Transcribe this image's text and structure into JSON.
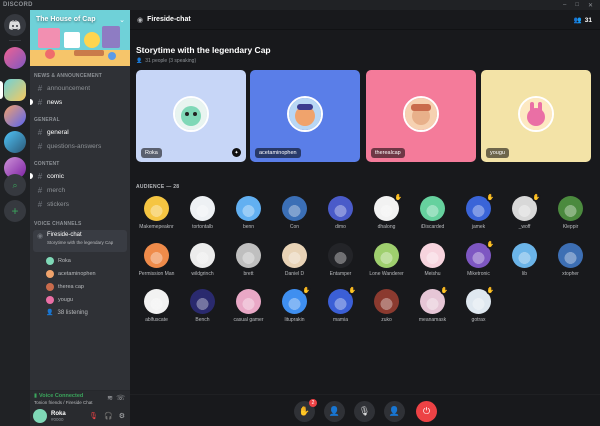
{
  "window": {
    "title": "DISCORD"
  },
  "servers": [
    {
      "name": "discord-home",
      "color": "#36393f"
    },
    {
      "name": "server-1",
      "color": "#9b59b6"
    },
    {
      "name": "server-2",
      "color": "#3ba55c"
    },
    {
      "name": "server-3",
      "color": "#faa61a"
    },
    {
      "name": "server-4",
      "color": "#5865f2"
    },
    {
      "name": "server-5",
      "color": "#eb459e"
    }
  ],
  "server": {
    "name": "The House of Cap"
  },
  "categories": {
    "news": "NEWS & ANNOUNCEMENT",
    "general": "GENERAL",
    "content": "CONTENT",
    "voice": "VOICE CHANNELS"
  },
  "channels": {
    "announcement": "announcement",
    "news": "news",
    "general": "general",
    "questions": "questions-answers",
    "comic": "comic",
    "merch": "merch",
    "stickers": "stickers",
    "fireside": "Fireside-chat",
    "fireside_topic": "Storytime with the legendary Cap"
  },
  "voice_users": [
    "Roka",
    "acetaminophen",
    "therea cap",
    "yougu"
  ],
  "listening": "38 listening",
  "voice_panel": {
    "status": "Voice Connected",
    "channel": "Tonion friends / Fireside Chat"
  },
  "user": {
    "name": "Roka",
    "tag": "#0000"
  },
  "stage": {
    "channel": "Fireside-chat",
    "member_count": "31",
    "title": "Storytime with the legendary Cap",
    "subtitle": "31 people (3 speaking)",
    "audience_label": "AUDIENCE — 28"
  },
  "speakers": [
    {
      "name": "Roka",
      "bg": "#c7d6f7",
      "avatar": "#7fd8b7"
    },
    {
      "name": "acetaminophen",
      "bg": "#5a7ee8",
      "avatar": "#f0a36c"
    },
    {
      "name": "therealcap",
      "bg": "#f47b9a",
      "avatar": "#c96b4c"
    },
    {
      "name": "yougu",
      "bg": "#f3e3a7",
      "avatar": "#ea6fa5"
    }
  ],
  "audience": [
    {
      "name": "Makemepeaknr",
      "color": "#f5c542",
      "hand": false
    },
    {
      "name": "tortontalb",
      "color": "#eef1f4",
      "hand": false
    },
    {
      "name": "benn",
      "color": "#62b0f1",
      "hand": false
    },
    {
      "name": "Con",
      "color": "#3b6fb6",
      "hand": false
    },
    {
      "name": "dimo",
      "color": "#4a5bc9",
      "hand": false
    },
    {
      "name": "dhalong",
      "color": "#f2f2f2",
      "hand": true
    },
    {
      "name": "iDiscarded",
      "color": "#66d19e",
      "hand": false
    },
    {
      "name": "jamek",
      "color": "#3a64d8",
      "hand": true
    },
    {
      "name": "_woff",
      "color": "#d8d8d8",
      "hand": true
    },
    {
      "name": "Kleppir",
      "color": "#4b8a3e",
      "hand": false
    },
    {
      "name": "Permission Man",
      "color": "#ef8b4a",
      "hand": false
    },
    {
      "name": "wildgrinch",
      "color": "#ececec",
      "hand": false
    },
    {
      "name": "brett",
      "color": "#bfbfbf",
      "hand": false
    },
    {
      "name": "Daniel D",
      "color": "#e8d3b6",
      "hand": false
    },
    {
      "name": "Entamper",
      "color": "#232428",
      "hand": false
    },
    {
      "name": "Lone Wanderer",
      "color": "#9fcf6e",
      "hand": false
    },
    {
      "name": "Meishu",
      "color": "#f7d4de",
      "hand": false
    },
    {
      "name": "Miketronic",
      "color": "#7e57c2",
      "hand": true
    },
    {
      "name": "lib",
      "color": "#6bb4e8",
      "hand": false
    },
    {
      "name": "xtopher",
      "color": "#3d6fb4",
      "hand": false
    },
    {
      "name": "ablfuscate",
      "color": "#f2f2f2",
      "hand": false
    },
    {
      "name": "Bench",
      "color": "#2a2a6e",
      "hand": false
    },
    {
      "name": "casual gamer",
      "color": "#e9a8c6",
      "hand": false
    },
    {
      "name": "lituprakin",
      "color": "#3f8ff0",
      "hand": true
    },
    {
      "name": "mamia",
      "color": "#3b5fd6",
      "hand": true
    },
    {
      "name": "zuko",
      "color": "#8b3a2f",
      "hand": false
    },
    {
      "name": "meanamask",
      "color": "#e6c6d6",
      "hand": true
    },
    {
      "name": "gotrax",
      "color": "#dfe8f0",
      "hand": true
    }
  ],
  "controls": {
    "hand_badge": "2"
  }
}
